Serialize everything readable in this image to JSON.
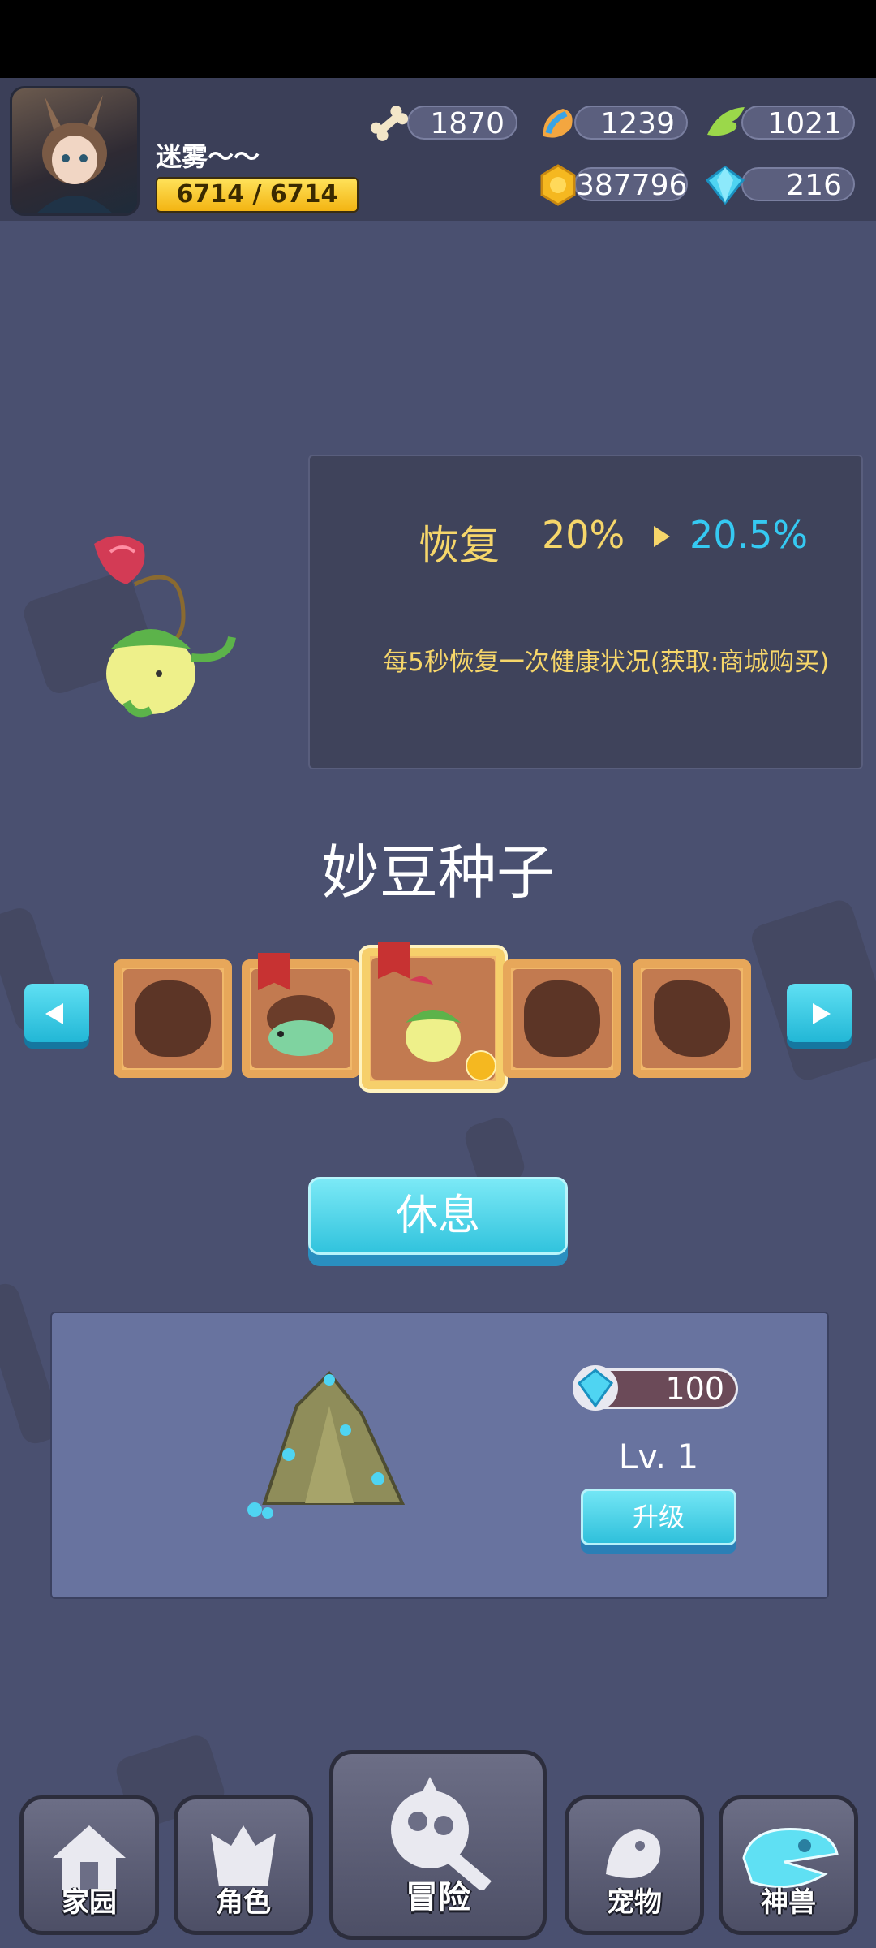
{
  "header": {
    "player_name": "迷雾～～",
    "hp_text": "6714 / 6714",
    "resources": [
      {
        "icon": "bone-icon",
        "value": "1870"
      },
      {
        "icon": "meat-icon",
        "value": "1239"
      },
      {
        "icon": "wing-icon",
        "value": "1021"
      },
      {
        "icon": "gold-coin-icon",
        "value": "387796"
      },
      {
        "icon": "diamond-icon",
        "value": "216"
      }
    ]
  },
  "pet_info": {
    "stat_label": "恢复",
    "current_value": "20%",
    "next_value": "20.5%",
    "description": "每5秒恢复一次健康状况(获取:商城购买)"
  },
  "pet_name": "妙豆种子",
  "carousel": {
    "slots": [
      {
        "state": "locked"
      },
      {
        "state": "owned"
      },
      {
        "state": "selected"
      },
      {
        "state": "locked"
      },
      {
        "state": "locked"
      }
    ]
  },
  "rest_button": "休息",
  "mine": {
    "cost": "100",
    "level": "Lv. 1",
    "upgrade_label": "升级"
  },
  "nav": [
    {
      "label": "家园",
      "icon": "home-icon"
    },
    {
      "label": "角色",
      "icon": "character-icon"
    },
    {
      "label": "冒险",
      "icon": "adventure-icon"
    },
    {
      "label": "宠物",
      "icon": "pet-icon"
    },
    {
      "label": "神兽",
      "icon": "divine-beast-icon"
    }
  ],
  "colors": {
    "background": "#4a5070",
    "accent_cyan": "#35c9f2",
    "stat_yellow": "#f6d66a"
  }
}
